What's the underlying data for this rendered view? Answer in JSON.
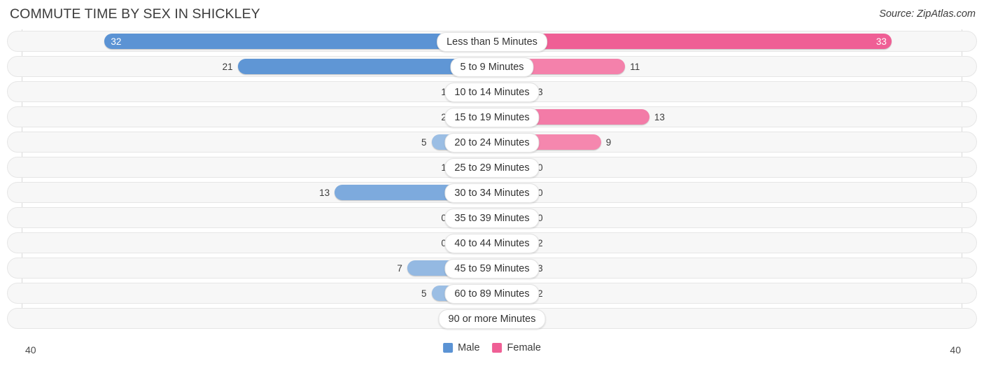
{
  "header": {
    "title": "COMMUTE TIME BY SEX IN SHICKLEY",
    "source": "Source: ZipAtlas.com"
  },
  "legend": {
    "male_label": "Male",
    "female_label": "Female",
    "male_color": "#5b93d4",
    "female_color": "#ef5f95"
  },
  "axis": {
    "left_max_label": "40",
    "right_max_label": "40"
  },
  "chart_data": {
    "type": "bar",
    "subtype": "diverging-bar",
    "title": "COMMUTE TIME BY SEX IN SHICKLEY",
    "xlabel": "",
    "ylabel": "",
    "axis_max": 40,
    "xlim": [
      -40,
      40
    ],
    "grid": false,
    "legend_position": "bottom-center",
    "categories": [
      "Less than 5 Minutes",
      "5 to 9 Minutes",
      "10 to 14 Minutes",
      "15 to 19 Minutes",
      "20 to 24 Minutes",
      "25 to 29 Minutes",
      "30 to 34 Minutes",
      "35 to 39 Minutes",
      "40 to 44 Minutes",
      "45 to 59 Minutes",
      "60 to 89 Minutes",
      "90 or more Minutes"
    ],
    "series": [
      {
        "name": "Male",
        "direction": "left",
        "color": "#5b93d4",
        "values": [
          32,
          21,
          1,
          2,
          5,
          1,
          13,
          0,
          0,
          7,
          5,
          0
        ]
      },
      {
        "name": "Female",
        "direction": "right",
        "color": "#ef5f95",
        "values": [
          33,
          11,
          3,
          13,
          9,
          0,
          0,
          0,
          2,
          3,
          2,
          0
        ]
      }
    ]
  }
}
